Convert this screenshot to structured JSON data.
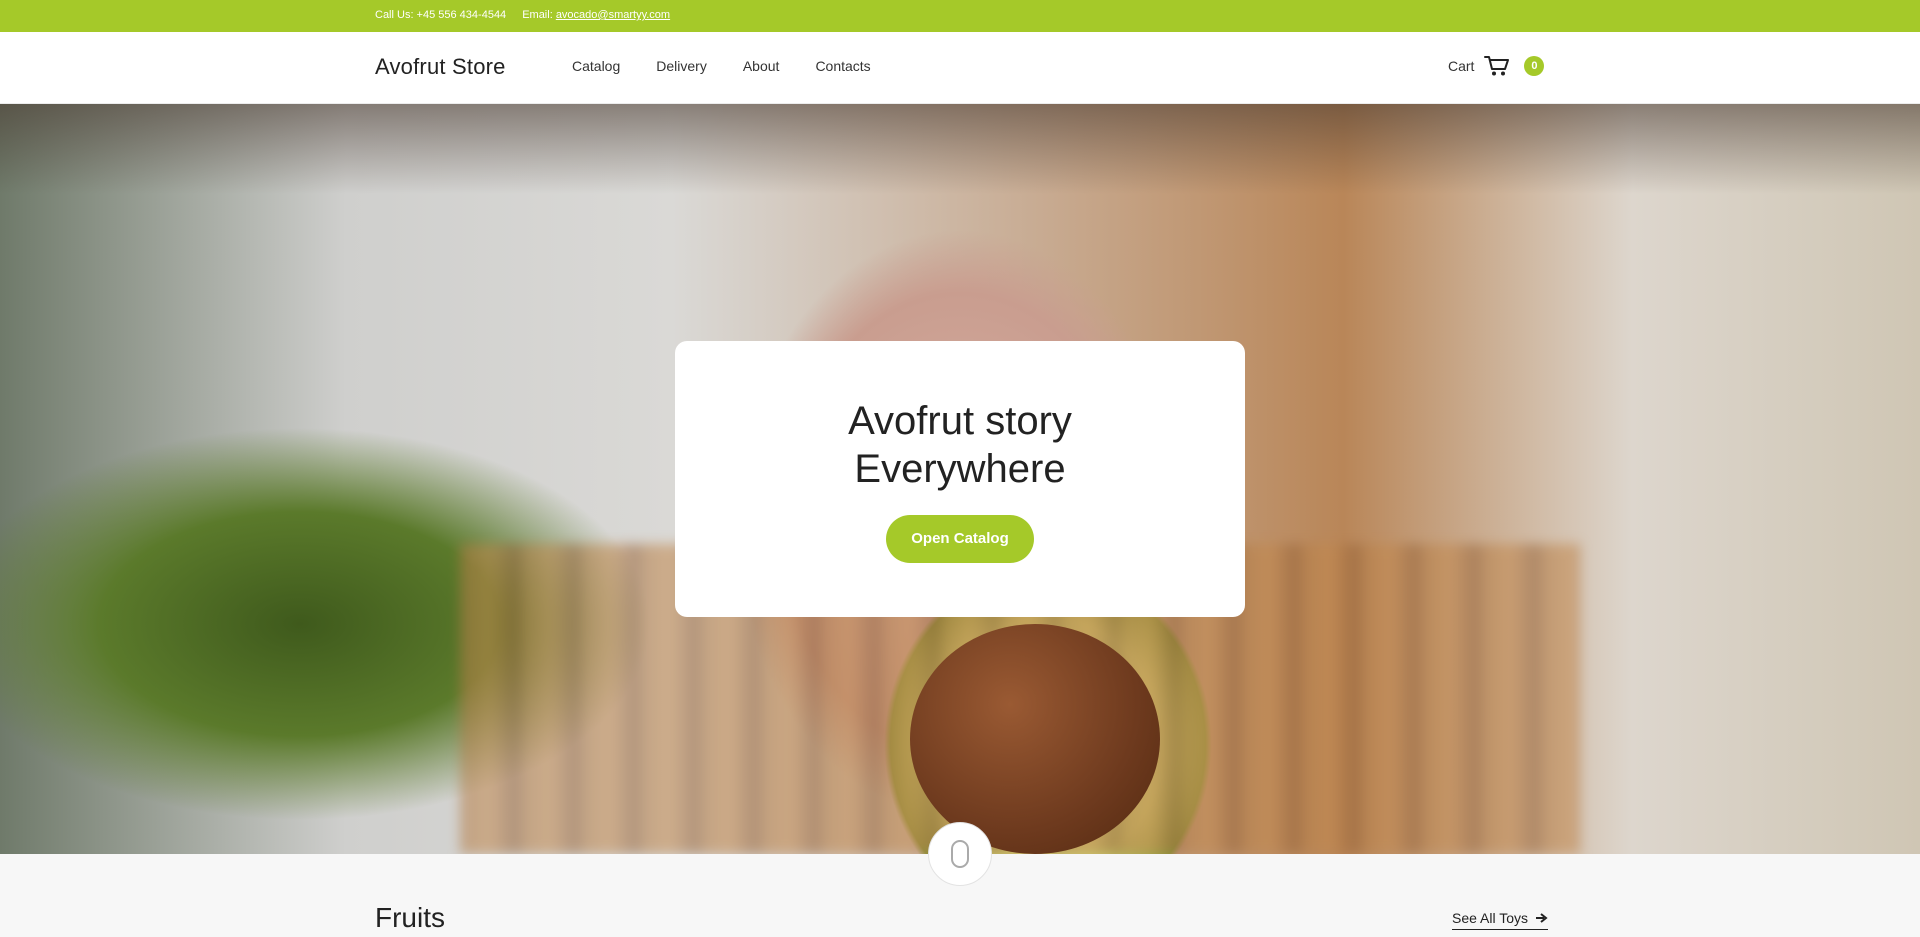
{
  "topbar": {
    "call_label": "Call Us: +45 556 434-4544",
    "email_prefix": "Email:",
    "email": "avocado@smartyy.com"
  },
  "header": {
    "logo": "Avofrut Store",
    "nav": [
      "Catalog",
      "Delivery",
      "About",
      "Contacts"
    ],
    "cart_label": "Cart",
    "cart_count": "0"
  },
  "hero": {
    "title_line1": "Avofrut story",
    "title_line2": "Everywhere",
    "button": "Open Catalog"
  },
  "section": {
    "title": "Fruits",
    "see_all": "See All Toys"
  },
  "colors": {
    "accent": "#a5c929"
  },
  "icons": {
    "cart": "cart-icon",
    "scroll": "mouse-scroll-icon",
    "arrow": "arrow-right-icon"
  }
}
